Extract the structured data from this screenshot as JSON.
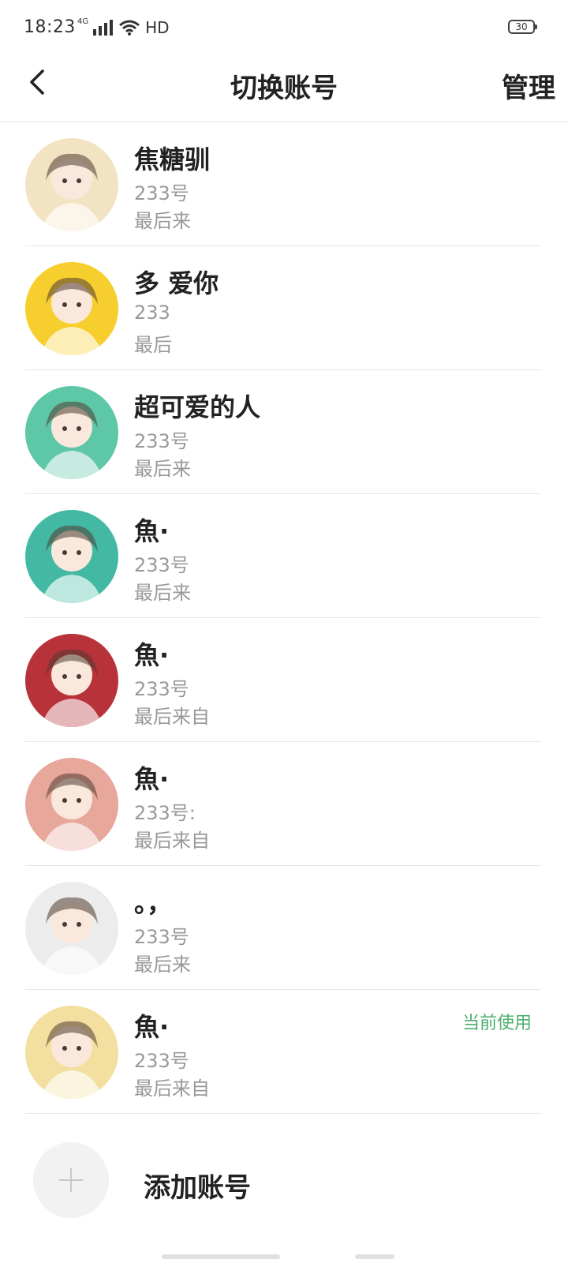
{
  "status_bar": {
    "time": "18:23",
    "signal": "4G",
    "network": "HD",
    "battery": "30"
  },
  "header": {
    "title": "切换账号",
    "manage_label": "管理"
  },
  "accounts": [
    {
      "name": "焦糖驯",
      "id_label": "233号",
      "last_label": "最后来",
      "current": false,
      "avatar_color": "#f2e3c2"
    },
    {
      "name": "多 爱你",
      "id_label": "233",
      "last_label": "最后",
      "current": false,
      "avatar_color": "#f6cf2e"
    },
    {
      "name": "超可爱的人",
      "id_label": "233号",
      "last_label": "最后来",
      "current": false,
      "avatar_color": "#5ec7a8"
    },
    {
      "name": "魚·",
      "id_label": "233号",
      "last_label": "最后来",
      "current": false,
      "avatar_color": "#43b9a4"
    },
    {
      "name": "魚·",
      "id_label": "233号",
      "last_label": "最后来自",
      "current": false,
      "avatar_color": "#b8323a"
    },
    {
      "name": "魚·",
      "id_label": "233号:",
      "last_label": "最后来自",
      "current": false,
      "avatar_color": "#e7a79b"
    },
    {
      "name": "。，",
      "id_label": "233号",
      "last_label": "最后来",
      "current": false,
      "avatar_color": "#ececec"
    },
    {
      "name": "魚·",
      "id_label": "233号",
      "last_label": "最后来自",
      "current": true,
      "avatar_color": "#f3dfa0"
    }
  ],
  "current_label": "当前使用",
  "add_account": {
    "label": "添加账号"
  }
}
